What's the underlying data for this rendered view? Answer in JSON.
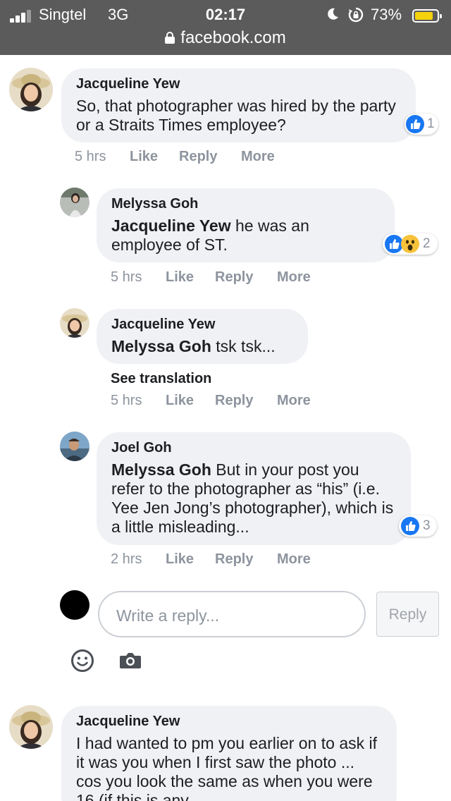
{
  "status_bar": {
    "carrier": "Singtel",
    "network": "3G",
    "time": "02:17",
    "battery_percent": "73%",
    "battery_level": 0.73,
    "url": "facebook.com",
    "icons": [
      "signal-icon",
      "moon-icon",
      "rotation-lock-icon",
      "battery-icon",
      "lock-icon"
    ]
  },
  "comments": [
    {
      "name": "Jacqueline Yew",
      "mention": "",
      "text": "So, that photographer was hired by the party or a Straits Times employee?",
      "time": "5 hrs",
      "reaction_count": "1",
      "reactions": [
        "like"
      ]
    },
    {
      "name": "Melyssa Goh",
      "mention": "Jacqueline Yew",
      "text": " he was an employee of ST.",
      "time": "5 hrs",
      "reaction_count": "2",
      "reactions": [
        "like",
        "wow"
      ]
    },
    {
      "name": "Jacqueline Yew",
      "mention": "Melyssa Goh",
      "text": " tsk tsk...",
      "time": "5 hrs",
      "see_translation": "See translation"
    },
    {
      "name": "Joel Goh",
      "mention": "Melyssa Goh",
      "text": " But in your post you refer to the photographer as “his” (i.e. Yee Jen Jong’s photographer), which is a little misleading...",
      "time": "2 hrs",
      "reaction_count": "3",
      "reactions": [
        "like"
      ]
    },
    {
      "name": "Jacqueline Yew",
      "mention": "",
      "text": "I had wanted to pm you earlier on to ask if it was you when I first saw the photo ... cos you look the same as when you were 16 (if this is any"
    }
  ],
  "actions": {
    "like": "Like",
    "reply": "Reply",
    "more": "More"
  },
  "composer": {
    "placeholder": "Write a reply...",
    "reply_button": "Reply",
    "icons": [
      "emoji-icon",
      "camera-icon"
    ]
  },
  "colors": {
    "like_blue": "#1877f2",
    "status_bar": "#5b5b5b",
    "bubble": "#f0f1f4",
    "meta_gray": "#8d949e"
  }
}
